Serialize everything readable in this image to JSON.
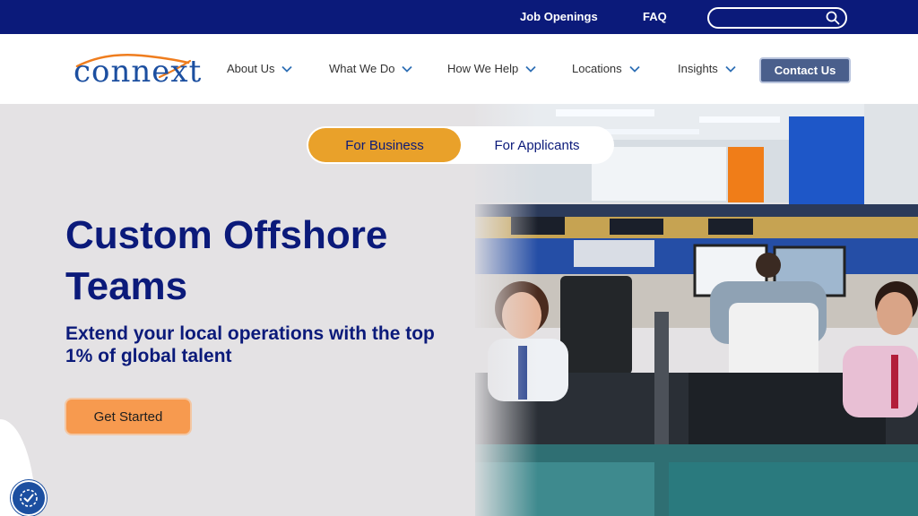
{
  "topbar": {
    "job_openings": "Job Openings",
    "faq": "FAQ",
    "search_placeholder": ""
  },
  "logo": {
    "text": "connext"
  },
  "nav": {
    "items": [
      {
        "label": "About Us"
      },
      {
        "label": "What We Do"
      },
      {
        "label": "How We Help"
      },
      {
        "label": "Locations"
      },
      {
        "label": "Insights"
      }
    ],
    "contact": "Contact Us"
  },
  "hero": {
    "toggle": {
      "business": "For Business",
      "applicants": "For Applicants",
      "selected": "For Business"
    },
    "headline": "Custom Offshore Teams",
    "subhead": "Extend your local operations with the top 1% of global talent",
    "cta": "Get Started"
  },
  "colors": {
    "navy": "#0b1a7a",
    "accent_orange": "#e9a12a",
    "cta_orange": "#f79a4f",
    "hero_bg": "#e4e2e4"
  },
  "icons": {
    "search": "search-icon",
    "chevron": "chevron-down-icon",
    "accessibility": "accessibility-icon"
  }
}
